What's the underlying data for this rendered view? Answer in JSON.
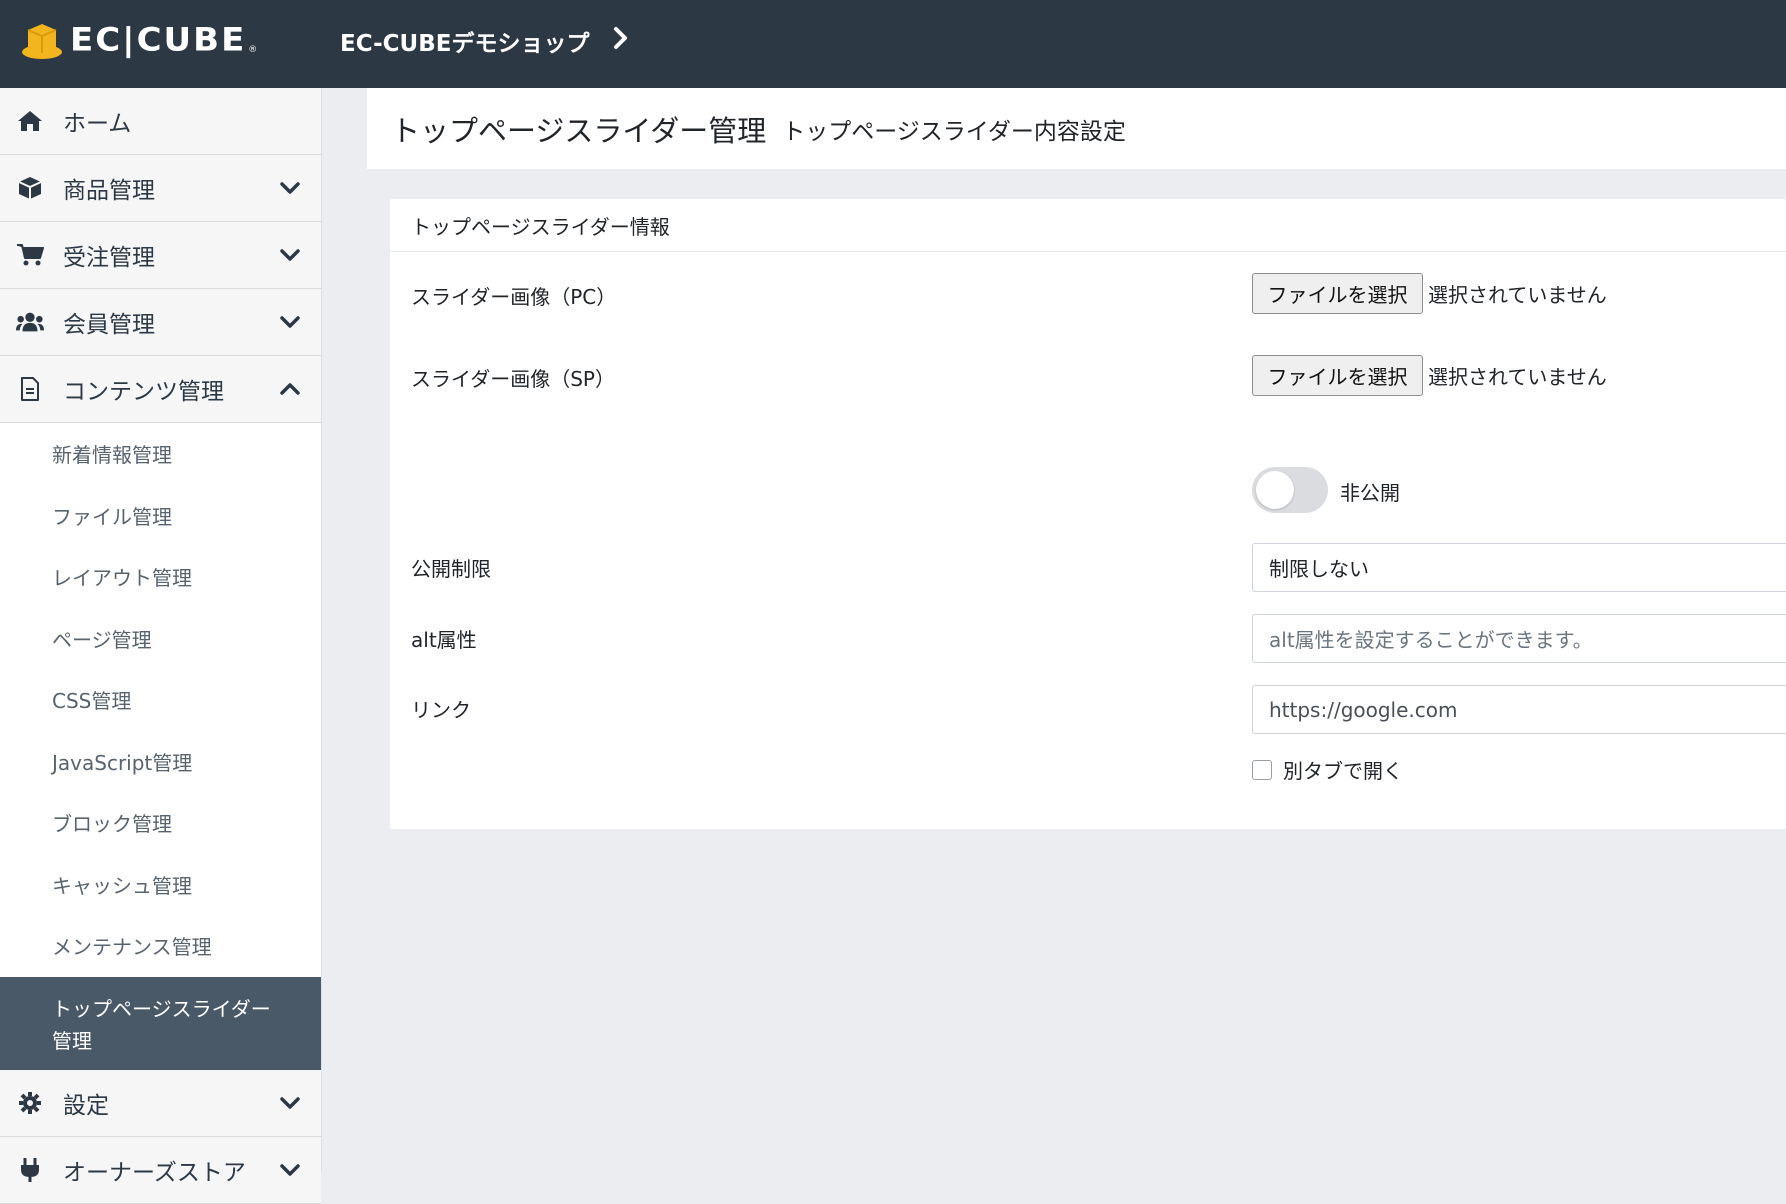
{
  "header": {
    "logo_text": "EC|CUBE",
    "logo_mark": "®",
    "shop_name": "EC-CUBEデモショップ"
  },
  "sidebar": {
    "items": [
      {
        "label": "ホーム",
        "icon": "home-icon"
      },
      {
        "label": "商品管理",
        "icon": "box-icon"
      },
      {
        "label": "受注管理",
        "icon": "cart-icon"
      },
      {
        "label": "会員管理",
        "icon": "users-icon"
      },
      {
        "label": "コンテンツ管理",
        "icon": "file-icon"
      },
      {
        "label": "設定",
        "icon": "gear-icon"
      },
      {
        "label": "オーナーズストア",
        "icon": "plug-icon"
      }
    ],
    "content_sub": [
      "新着情報管理",
      "ファイル管理",
      "レイアウト管理",
      "ページ管理",
      "CSS管理",
      "JavaScript管理",
      "ブロック管理",
      "キャッシュ管理",
      "メンテナンス管理"
    ],
    "active_line1": "トップページスライダー",
    "active_line2": "管理"
  },
  "page": {
    "title": "トップページスライダー管理",
    "subtitle": "トップページスライダー内容設定"
  },
  "card": {
    "header": "トップページスライダー情報",
    "pc_label": "スライダー画像（PC）",
    "sp_label": "スライダー画像（SP）",
    "file_button": "ファイルを選択",
    "file_status": "選択されていません",
    "toggle_label": "非公開",
    "toggle_on": false,
    "restriction_label": "公開制限",
    "restriction_value": "制限しない",
    "alt_label": "alt属性",
    "alt_placeholder": "alt属性を設定することができます。",
    "link_label": "リンク",
    "link_value": "https://google.com",
    "new_tab_label": "別タブで開く",
    "new_tab_checked": false
  },
  "colors": {
    "header_bg": "#2d3845",
    "sidebar_bg": "#f6f6f7",
    "active_bg": "#4a5968",
    "page_bg": "#ebedf0",
    "logo_gold": "#f2b51e"
  }
}
